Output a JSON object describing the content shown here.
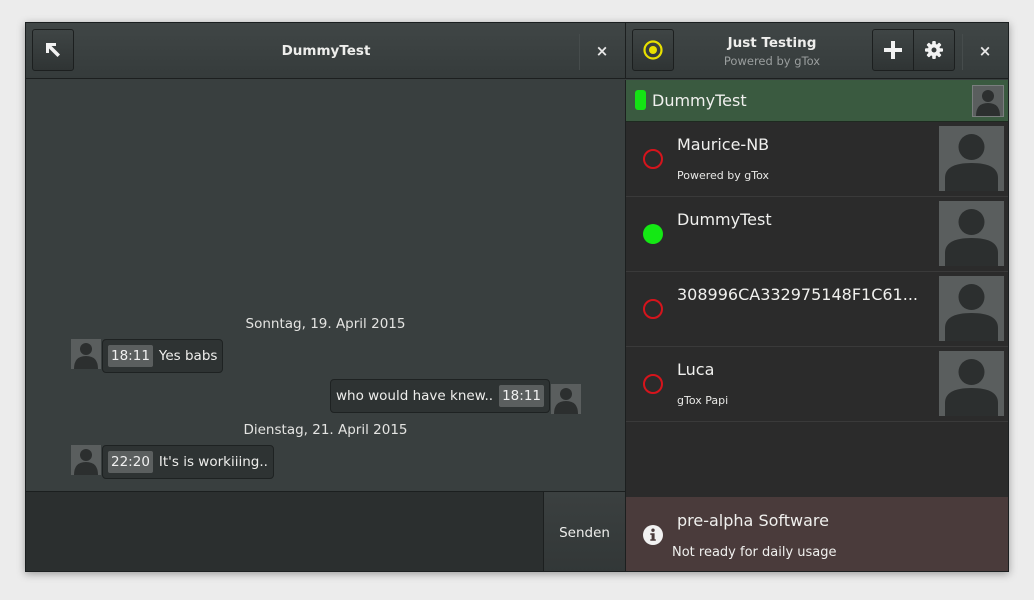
{
  "chat_header": {
    "title": "DummyTest",
    "back_icon": "arrow-up-left-icon",
    "close_label": "×"
  },
  "main_header": {
    "title": "Just Testing",
    "subtitle": "Powered by gTox",
    "status_icon": "status-ring-icon",
    "add_icon": "plus-icon",
    "settings_icon": "gear-icon",
    "close_label": "×",
    "status_color": "#e8e000"
  },
  "chat": {
    "days": [
      {
        "date": "Sonntag, 19. April 2015",
        "messages": [
          {
            "side": "left",
            "time": "18:11",
            "text": "Yes babs"
          },
          {
            "side": "right",
            "time": "18:11",
            "text": "who would have knew.."
          }
        ]
      },
      {
        "date": "Dienstag, 21. April 2015",
        "messages": [
          {
            "side": "left",
            "time": "22:20",
            "text": "It's is workiiing.."
          }
        ]
      }
    ]
  },
  "input": {
    "value": "",
    "send_label": "Senden"
  },
  "self": {
    "name": "DummyTest",
    "status_color": "#14e314"
  },
  "contacts": [
    {
      "name": "Maurice-NB",
      "status": "offline",
      "status_message": "Powered by gTox"
    },
    {
      "name": "DummyTest",
      "status": "online",
      "status_message": ""
    },
    {
      "name": "308996CA332975148F1C61...",
      "status": "offline",
      "status_message": ""
    },
    {
      "name": "Luca",
      "status": "offline",
      "status_message": "gTox Papi"
    }
  ],
  "notice": {
    "icon": "info-icon",
    "title": "pre-alpha Software",
    "text": "Not ready for daily usage"
  },
  "colors": {
    "online": "#14e814",
    "offline": "#d6141c",
    "self_row_bg": "#3a5a40",
    "notice_bg": "#4a3b3b"
  }
}
